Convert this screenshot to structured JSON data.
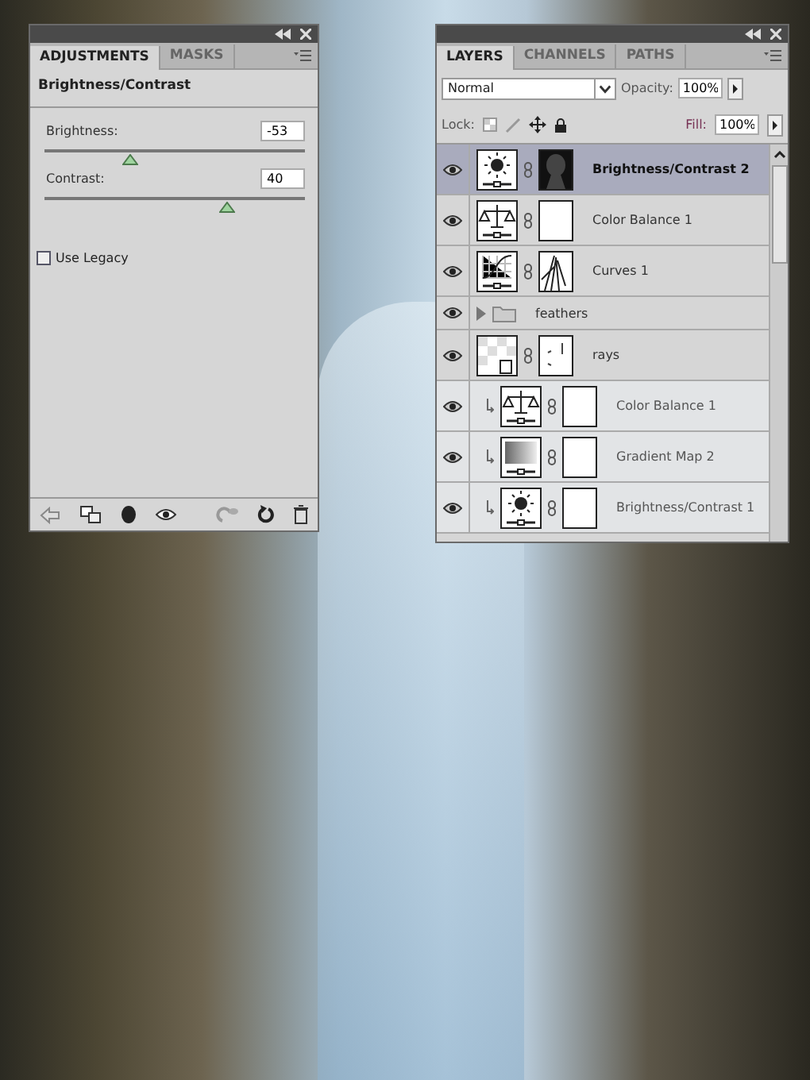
{
  "adjustments_panel": {
    "tabs": [
      {
        "label": "ADJUSTMENTS",
        "selected": true
      },
      {
        "label": "MASKS",
        "selected": false
      }
    ],
    "title": "Brightness/Contrast",
    "sliders": [
      {
        "label": "Brightness:",
        "value": "-53",
        "level": 0.33
      },
      {
        "label": "Contrast:",
        "value": "40",
        "level": 0.7
      }
    ],
    "use_legacy": {
      "label": "Use Legacy",
      "checked": false
    }
  },
  "layers_panel": {
    "tabs": [
      {
        "label": "LAYERS",
        "selected": true
      },
      {
        "label": "CHANNELS",
        "selected": false
      },
      {
        "label": "PATHS",
        "selected": false
      }
    ],
    "blend_mode": "Normal",
    "opacity_label": "Opacity:",
    "opacity": "100%",
    "lock_label": "Lock:",
    "fill_label": "Fill:",
    "fill": "100%",
    "layers": [
      {
        "name": "Brightness/Contrast 2",
        "kind": "brightness",
        "mask": {
          "kind": "figure"
        },
        "selected": true,
        "clipped": false
      },
      {
        "name": "Color Balance 1",
        "kind": "balance",
        "mask": {
          "kind": "blank"
        },
        "selected": false,
        "clipped": false
      },
      {
        "name": "Curves 1",
        "kind": "curves",
        "mask": {
          "kind": "strokes"
        },
        "selected": false,
        "clipped": false
      },
      {
        "name": "feathers",
        "kind": "group",
        "selected": false,
        "clipped": false
      },
      {
        "name": "rays",
        "kind": "smart",
        "mask": {
          "kind": "dots"
        },
        "selected": false,
        "clipped": false
      },
      {
        "name": "Color Balance 1",
        "kind": "balance",
        "mask": {
          "kind": "blank"
        },
        "selected": false,
        "clipped": true
      },
      {
        "name": "Gradient Map 2",
        "kind": "gradient",
        "mask": {
          "kind": "blank"
        },
        "selected": false,
        "clipped": true
      },
      {
        "name": "Brightness/Contrast 1",
        "kind": "brightness",
        "mask": {
          "kind": "blank"
        },
        "selected": false,
        "clipped": true
      }
    ]
  }
}
